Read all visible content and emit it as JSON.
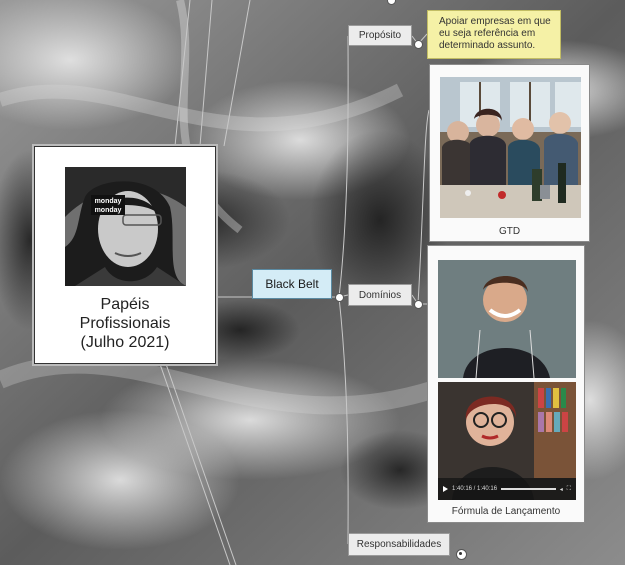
{
  "central": {
    "title_lines": [
      "Papéis",
      "Profissionais",
      "(Julho 2021)"
    ],
    "badge_text": [
      "monday",
      "monday"
    ]
  },
  "subtopic": {
    "label": "Black Belt"
  },
  "topics": {
    "proposito": "Propósito",
    "dominios": "Domínios",
    "responsabilidades": "Responsabilidades"
  },
  "note": {
    "lines": [
      "Apoiar empresas em que",
      "eu seja referência em",
      "determinado assunto."
    ]
  },
  "cards": {
    "gtd": {
      "caption": "GTD"
    },
    "formula": {
      "caption": "Fórmula de Lançamento",
      "video_time": "1:40:16 / 1:40:16"
    }
  },
  "colors": {
    "topic_fill": "#ececec",
    "subtopic_fill": "#d4ecf6",
    "note_fill": "#f5f1a6",
    "connector": "#c8c8c8"
  },
  "icons": [
    "play-icon",
    "volume-icon",
    "fullscreen-icon",
    "connector-dot-icon",
    "expand-dot-icon"
  ]
}
